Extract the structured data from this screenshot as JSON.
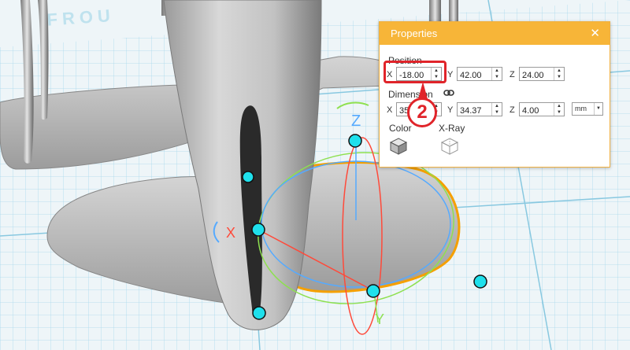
{
  "viewport": {
    "watermark": "FROU",
    "axis_labels": {
      "x": "X",
      "y": "Y",
      "z": "Z"
    }
  },
  "panel": {
    "title": "Properties",
    "close_glyph": "✕",
    "position": {
      "label": "Position",
      "x_label": "X",
      "x_value": "-18.00",
      "y_label": "Y",
      "y_value": "42.00",
      "z_label": "Z",
      "z_value": "24.00"
    },
    "dimension": {
      "label": "Dimension",
      "x_label": "X",
      "x_value": "35",
      "y_label": "Y",
      "y_value": "34.37",
      "z_label": "Z",
      "z_value": "4.00",
      "unit": "mm"
    },
    "color_label": "Color",
    "xray_label": "X-Ray"
  },
  "callout": {
    "number": "2"
  },
  "colors": {
    "accent": "#f7b538",
    "callout": "#e0242a",
    "handle": "#1fe0ec"
  }
}
